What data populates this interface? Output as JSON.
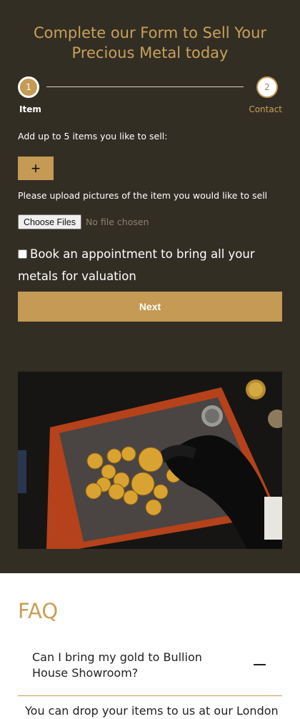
{
  "form": {
    "title_line1": "Complete our Form to Sell Your",
    "title_line2": "Precious Metal today",
    "steps": [
      {
        "number": "1",
        "label": "Item"
      },
      {
        "number": "2",
        "label": "Contact"
      }
    ],
    "add_items_label": "Add up to 5 items you like to sell:",
    "add_button": "+",
    "upload_label": "Please upload pictures of the item you would like to sell",
    "file_button": "Choose Files",
    "file_status": "No file chosen",
    "appointment_label": "Book an appointment to bring all your metals for valuation",
    "next_button": "Next"
  },
  "faq": {
    "title": "FAQ",
    "question": "Can I bring my gold to Bullion House Showroom?",
    "answer_partial": "You can drop your items to us at our London"
  },
  "colors": {
    "background_dark": "#332e24",
    "accent_gold": "#c49a55"
  }
}
